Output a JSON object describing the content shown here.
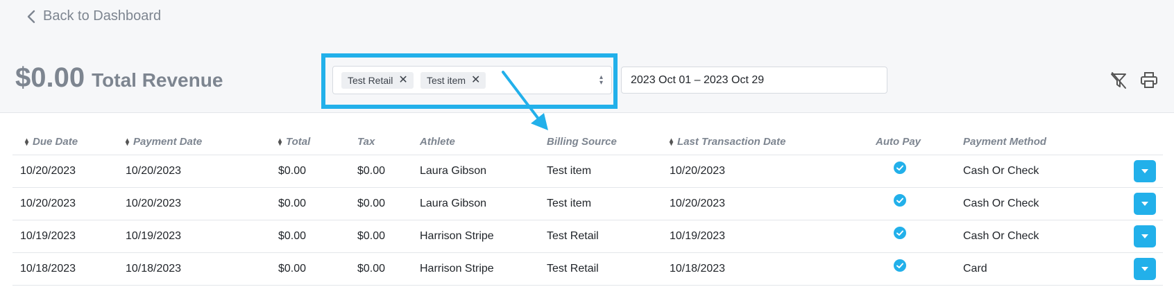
{
  "nav": {
    "back_label": "Back to Dashboard"
  },
  "summary": {
    "amount": "$0.00",
    "label": "Total Revenue"
  },
  "filters": {
    "tags": [
      {
        "label": "Test Retail"
      },
      {
        "label": "Test item"
      }
    ],
    "date_range": "2023 Oct 01 – 2023 Oct 29"
  },
  "colors": {
    "accent": "#22b0ea",
    "muted": "#7d8590"
  },
  "table": {
    "columns": [
      {
        "label": "Due Date",
        "sortable": true
      },
      {
        "label": "Payment Date",
        "sortable": true
      },
      {
        "label": "Total",
        "sortable": true
      },
      {
        "label": "Tax",
        "sortable": false
      },
      {
        "label": "Athlete",
        "sortable": false
      },
      {
        "label": "Billing Source",
        "sortable": false
      },
      {
        "label": "Last Transaction Date",
        "sortable": true
      },
      {
        "label": "Auto Pay",
        "sortable": false
      },
      {
        "label": "Payment Method",
        "sortable": false
      }
    ],
    "rows": [
      {
        "due_date": "10/20/2023",
        "payment_date": "10/20/2023",
        "total": "$0.00",
        "tax": "$0.00",
        "athlete": "Laura Gibson",
        "billing_source": "Test item",
        "last_transaction": "10/20/2023",
        "auto_pay": true,
        "payment_method": "Cash Or Check"
      },
      {
        "due_date": "10/20/2023",
        "payment_date": "10/20/2023",
        "total": "$0.00",
        "tax": "$0.00",
        "athlete": "Laura Gibson",
        "billing_source": "Test item",
        "last_transaction": "10/20/2023",
        "auto_pay": true,
        "payment_method": "Cash Or Check"
      },
      {
        "due_date": "10/19/2023",
        "payment_date": "10/19/2023",
        "total": "$0.00",
        "tax": "$0.00",
        "athlete": "Harrison Stripe",
        "billing_source": "Test Retail",
        "last_transaction": "10/19/2023",
        "auto_pay": true,
        "payment_method": "Cash Or Check"
      },
      {
        "due_date": "10/18/2023",
        "payment_date": "10/18/2023",
        "total": "$0.00",
        "tax": "$0.00",
        "athlete": "Harrison Stripe",
        "billing_source": "Test Retail",
        "last_transaction": "10/18/2023",
        "auto_pay": true,
        "payment_method": "Card"
      }
    ]
  }
}
